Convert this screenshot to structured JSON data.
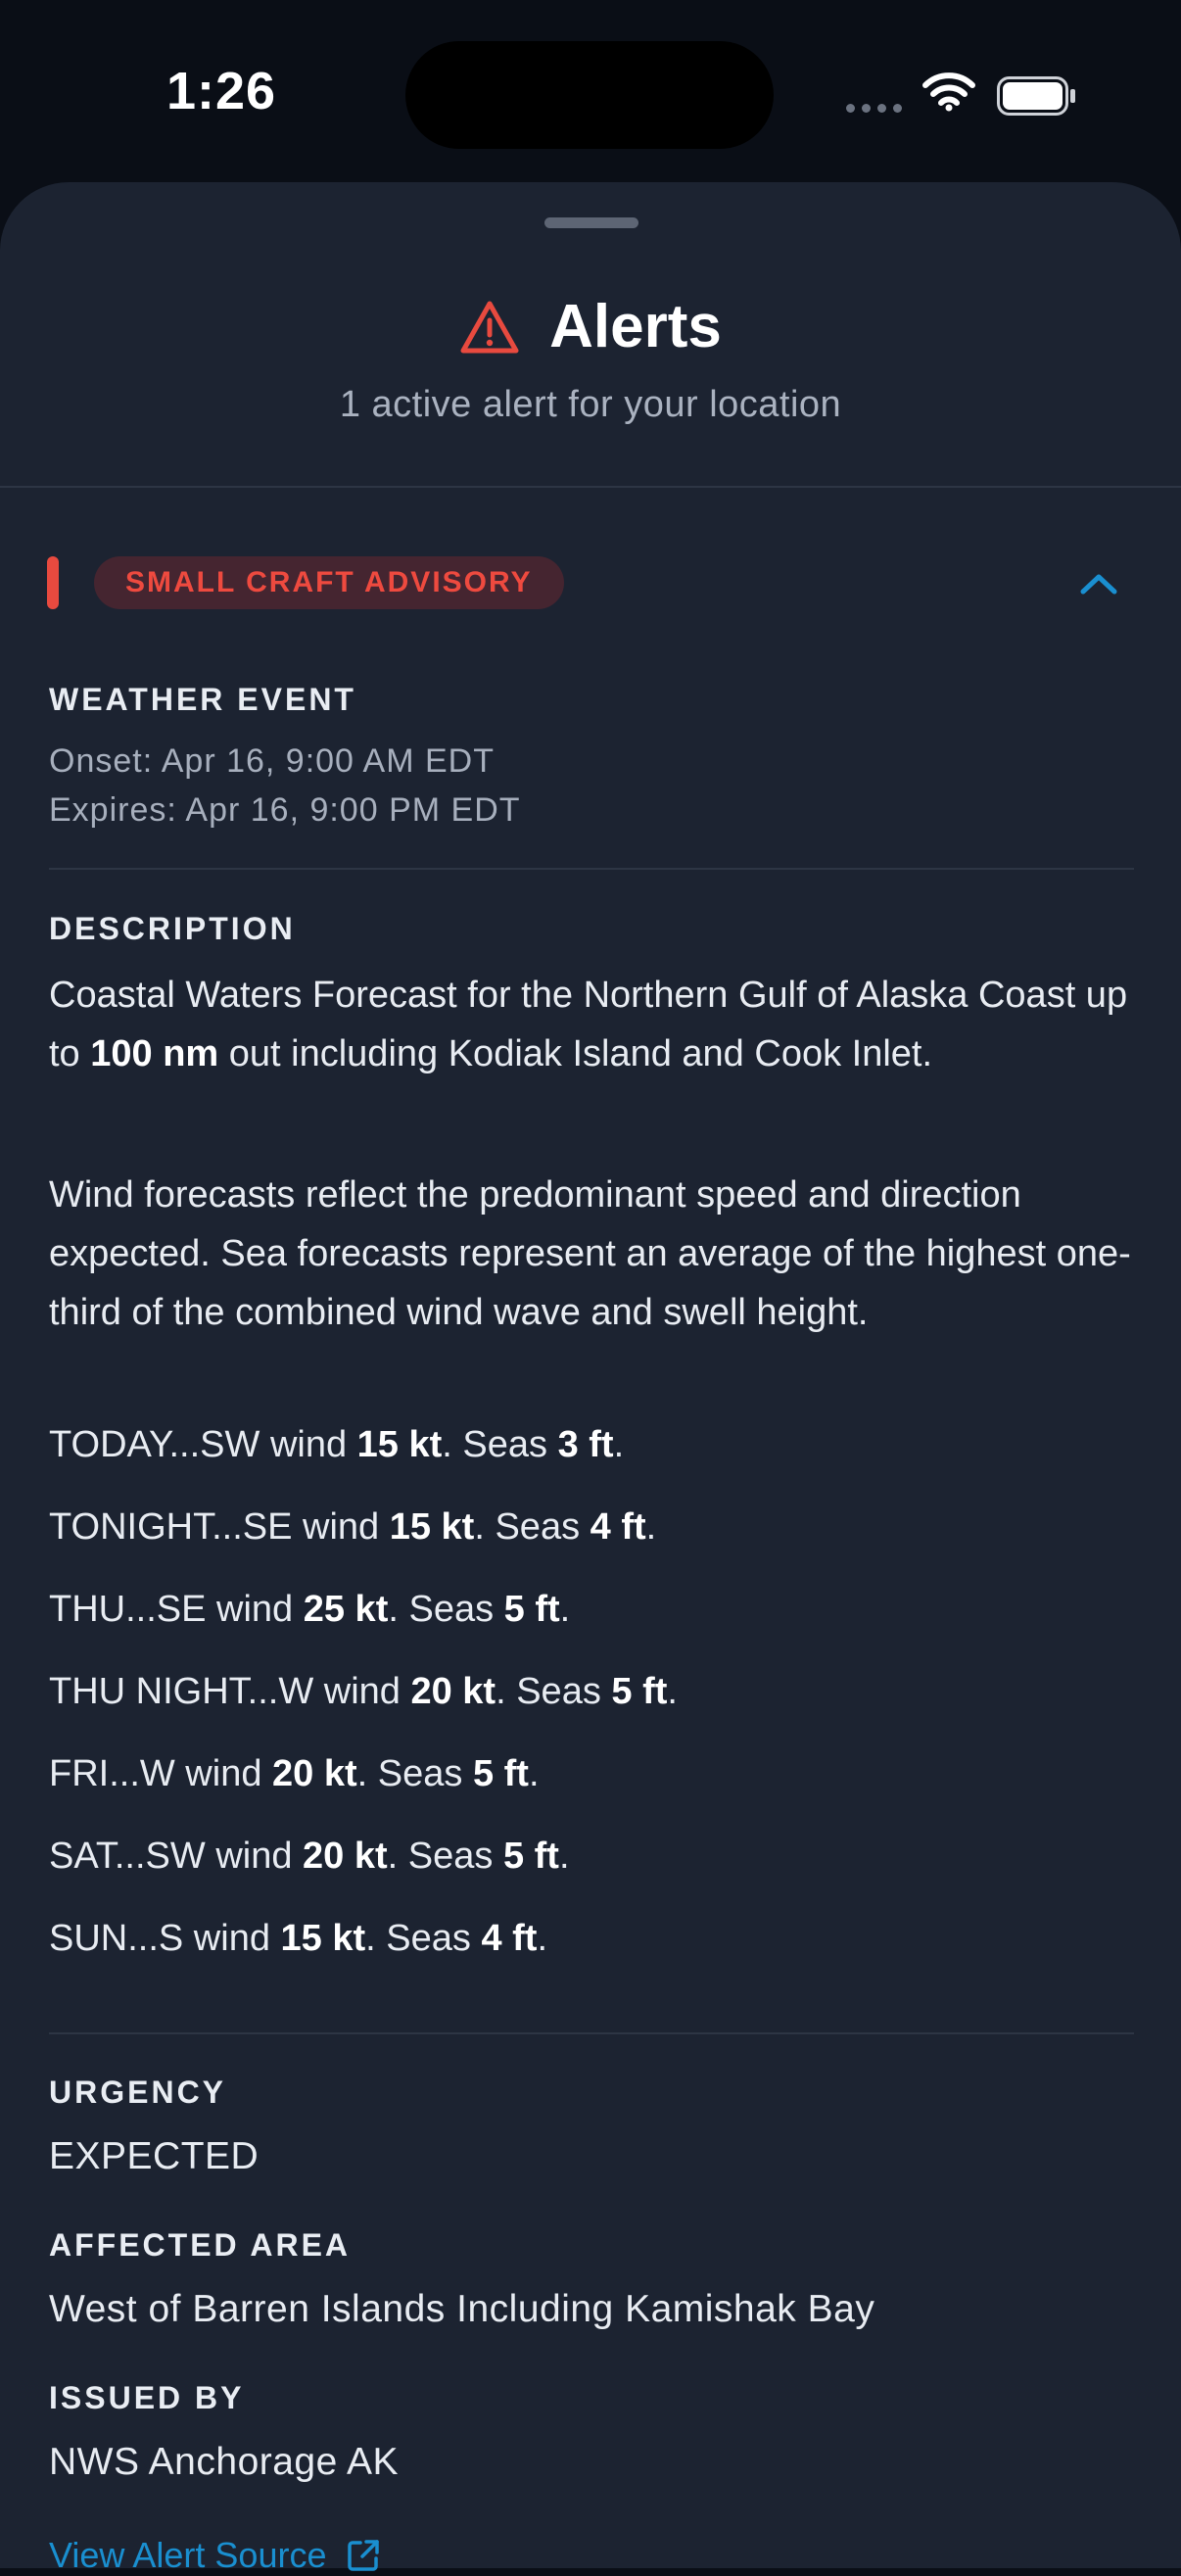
{
  "status_bar": {
    "time": "1:26"
  },
  "header": {
    "title": "Alerts",
    "subtitle": "1 active alert for your location",
    "icon": "warning-triangle-icon"
  },
  "colors": {
    "accent_red": "#e84a3f",
    "link_blue": "#1a8fd0",
    "sheet_bg": "#1c2331"
  },
  "alert": {
    "badge": "SMALL CRAFT ADVISORY",
    "event_label": "WEATHER EVENT",
    "onset": "Onset: Apr 16, 9:00 AM EDT",
    "expires": "Expires: Apr 16, 9:00 PM EDT",
    "description_label": "DESCRIPTION",
    "description": {
      "p1a": "Coastal Waters Forecast for the Northern Gulf of Alaska Coast up to ",
      "p1b": "100 nm",
      "p1c": " out including Kodiak Island and Cook Inlet.",
      "p2": "Wind forecasts reflect the predominant speed and direction expected. Sea forecasts represent an average of the highest one-third of the combined wind wave and swell height."
    },
    "forecast": [
      {
        "a": "TODAY...SW wind ",
        "wind": "15 kt",
        "b": ". Seas ",
        "seas": "3 ft",
        "c": "."
      },
      {
        "a": "TONIGHT...SE wind ",
        "wind": "15 kt",
        "b": ". Seas ",
        "seas": "4 ft",
        "c": "."
      },
      {
        "a": "THU...SE wind ",
        "wind": "25 kt",
        "b": ". Seas ",
        "seas": "5 ft",
        "c": "."
      },
      {
        "a": "THU NIGHT...W wind ",
        "wind": "20 kt",
        "b": ". Seas ",
        "seas": "5 ft",
        "c": "."
      },
      {
        "a": "FRI...W wind ",
        "wind": "20 kt",
        "b": ". Seas ",
        "seas": "5 ft",
        "c": "."
      },
      {
        "a": "SAT...SW wind ",
        "wind": "20 kt",
        "b": ". Seas ",
        "seas": "5 ft",
        "c": "."
      },
      {
        "a": "SUN...S wind ",
        "wind": "15 kt",
        "b": ". Seas ",
        "seas": "4 ft",
        "c": "."
      }
    ],
    "urgency_label": "URGENCY",
    "urgency": "EXPECTED",
    "area_label": "AFFECTED AREA",
    "area": "West of Barren Islands Including Kamishak Bay",
    "issued_label": "ISSUED BY",
    "issued_by": "NWS Anchorage AK",
    "source_link": "View Alert Source"
  }
}
